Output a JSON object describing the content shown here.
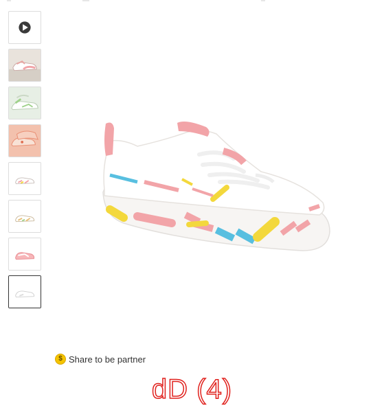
{
  "gallery": {
    "thumbnails": [
      {
        "kind": "video",
        "icon": "play-icon"
      },
      {
        "kind": "image",
        "tint": "#e9c7c0"
      },
      {
        "kind": "image",
        "tint": "#cfe3c9"
      },
      {
        "kind": "image",
        "tint": "#f2a48c"
      },
      {
        "kind": "image",
        "tint": "#f6d0d0"
      },
      {
        "kind": "image",
        "tint": "#efd6a8"
      },
      {
        "kind": "image",
        "tint": "#f7b6b9"
      },
      {
        "kind": "image",
        "tint": "#e8e8e8",
        "selected": true
      }
    ]
  },
  "share": {
    "icon": "coin-icon",
    "coin_symbol": "$",
    "label": "Share to be partner"
  },
  "watermark": "dD (4)",
  "colors": {
    "pink": "#f2a4a8",
    "yellow": "#f3d83c",
    "blue": "#58bfe0",
    "accent_red": "#e0201c"
  }
}
